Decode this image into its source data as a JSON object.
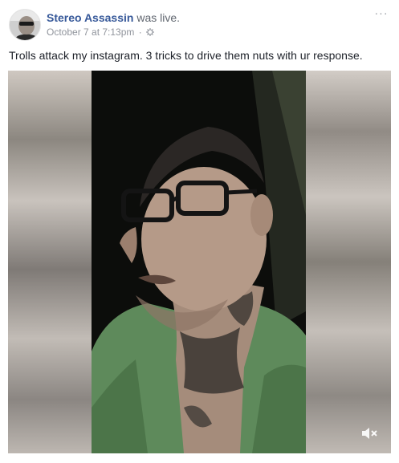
{
  "post": {
    "author_name": "Stereo Assassin",
    "action_text": "was live.",
    "timestamp": "October 7 at 7:13pm",
    "separator": "·",
    "audience_icon": "public-globe-icon",
    "more_options_label": "···",
    "caption": "Trolls attack my instagram. 3 tricks to drive them nuts with ur response."
  },
  "video": {
    "subject": "man with glasses and neck tattoos speaking to camera",
    "mute_icon": "speaker-muted-icon"
  },
  "colors": {
    "author_link": "#365899",
    "secondary_text": "#90949c",
    "body_text": "#1d2129",
    "shirt_green": "#5e8a5b"
  }
}
